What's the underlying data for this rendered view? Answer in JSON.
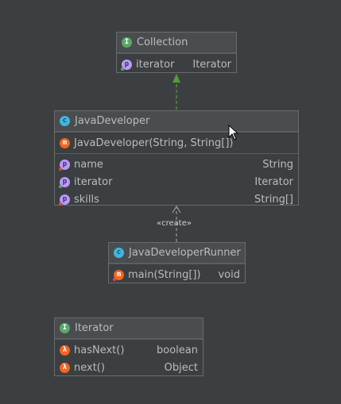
{
  "diagram": {
    "background_color": "#3c3f41",
    "nodes": {
      "collection": {
        "icon": "interface-icon",
        "title": "Collection",
        "members": [
          {
            "icon": "property-icon",
            "name": "iterator",
            "type": "Iterator"
          }
        ]
      },
      "java_developer": {
        "icon": "class-icon",
        "title": "JavaDeveloper",
        "constructors": [
          {
            "icon": "method-icon",
            "name": "JavaDeveloper(String, String[])"
          }
        ],
        "members": [
          {
            "icon": "property-icon",
            "name": "name",
            "type": "String"
          },
          {
            "icon": "property-icon",
            "name": "iterator",
            "type": "Iterator"
          },
          {
            "icon": "property-icon",
            "name": "skills",
            "type": "String[]"
          }
        ]
      },
      "java_developer_runner": {
        "icon": "class-icon",
        "title": "JavaDeveloperRunner",
        "members": [
          {
            "icon": "method-icon",
            "name": "main(String[])",
            "type": "void"
          }
        ]
      },
      "iterator": {
        "icon": "interface-icon",
        "title": "Iterator",
        "members": [
          {
            "icon": "lambda-method-icon",
            "name": "hasNext()",
            "type": "boolean"
          },
          {
            "icon": "lambda-method-icon",
            "name": "next()",
            "type": "Object"
          }
        ]
      }
    },
    "edges": {
      "implements_color": "#4f9e3a",
      "create_label": "«create»",
      "create_color": "#a8a8a8"
    }
  }
}
